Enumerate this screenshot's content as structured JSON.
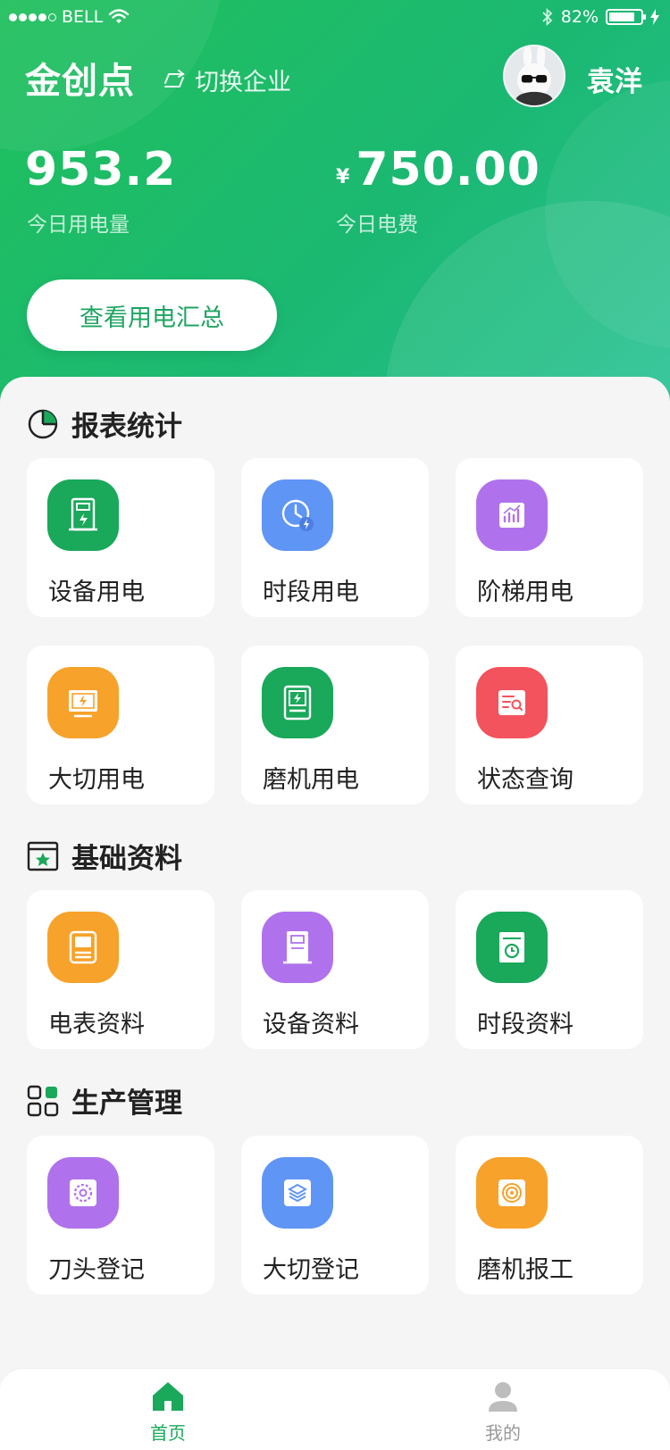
{
  "status_bar": {
    "carrier": "BELL",
    "battery": "82%",
    "battery_level": 0.82
  },
  "header": {
    "company": "金创点",
    "switch_label": "切换企业",
    "user_name": "袁洋",
    "stats": [
      {
        "value": "953.2",
        "label": "今日用电量",
        "currency": ""
      },
      {
        "value": "750.00",
        "label": "今日电费",
        "currency": "¥"
      }
    ],
    "summary_button": "查看用电汇总"
  },
  "sections": [
    {
      "title": "报表统计",
      "icon": "pie-chart-icon",
      "items": [
        {
          "label": "设备用电",
          "icon": "device-power-icon",
          "color": "#1aa85a"
        },
        {
          "label": "时段用电",
          "icon": "clock-power-icon",
          "color": "#5f95f5"
        },
        {
          "label": "阶梯用电",
          "icon": "tier-chart-icon",
          "color": "#b072ec"
        },
        {
          "label": "大切用电",
          "icon": "big-cut-power-icon",
          "color": "#f7a22a"
        },
        {
          "label": "磨机用电",
          "icon": "grinder-power-icon",
          "color": "#1aa85a"
        },
        {
          "label": "状态查询",
          "icon": "status-query-icon",
          "color": "#f2535d"
        }
      ]
    },
    {
      "title": "基础资料",
      "icon": "star-folder-icon",
      "items": [
        {
          "label": "电表资料",
          "icon": "meter-info-icon",
          "color": "#f7a22a"
        },
        {
          "label": "设备资料",
          "icon": "device-info-icon",
          "color": "#b072ec"
        },
        {
          "label": "时段资料",
          "icon": "period-info-icon",
          "color": "#1aa85a"
        }
      ]
    },
    {
      "title": "生产管理",
      "icon": "grid-apps-icon",
      "items": [
        {
          "label": "刀头登记",
          "icon": "blade-gear-icon",
          "color": "#b072ec"
        },
        {
          "label": "大切登记",
          "icon": "layers-icon",
          "color": "#5f95f5"
        },
        {
          "label": "磨机报工",
          "icon": "grinder-disc-icon",
          "color": "#f7a22a"
        }
      ]
    }
  ],
  "tabbar": {
    "items": [
      {
        "label": "首页",
        "icon": "home-icon",
        "active": true
      },
      {
        "label": "我的",
        "icon": "user-icon",
        "active": false
      }
    ],
    "active_color": "#1aa85a",
    "inactive_color": "#999999"
  }
}
